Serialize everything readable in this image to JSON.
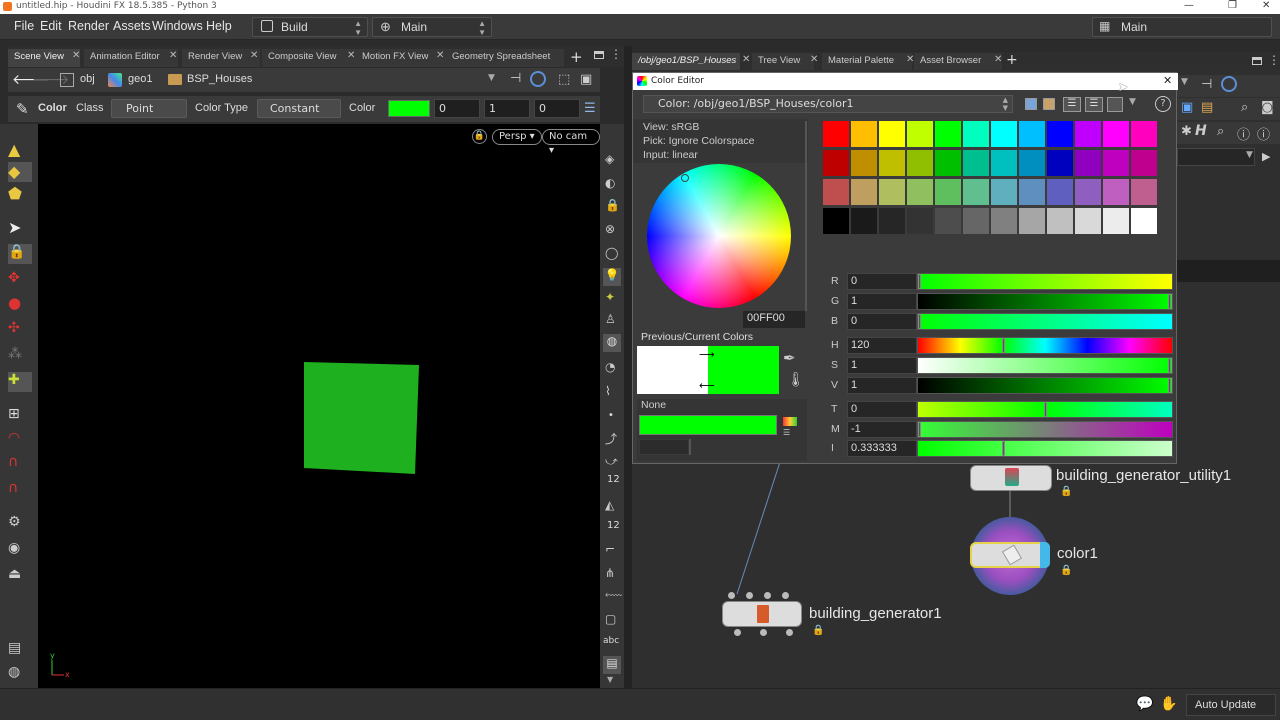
{
  "window": {
    "title": "untitled.hip - Houdini FX 18.5.385 - Python 3",
    "controls": [
      "—",
      "❐",
      "✕"
    ]
  },
  "menu": {
    "items": [
      "File",
      "Edit",
      "Render",
      "Assets",
      "Windows",
      "Help"
    ],
    "desktop": "Build",
    "main_left": "Main",
    "main_right": "Main"
  },
  "left_tabs": [
    {
      "label": "Scene View",
      "active": true
    },
    {
      "label": "Animation Editor"
    },
    {
      "label": "Render View"
    },
    {
      "label": "Composite View"
    },
    {
      "label": "Motion FX View"
    },
    {
      "label": "Geometry Spreadsheet"
    }
  ],
  "left_path": {
    "root": "obj",
    "geo": "geo1",
    "node": "BSP_Houses"
  },
  "parm": {
    "color_label": "Color",
    "class_label": "Class",
    "class_value": "Point",
    "color_type_label": "Color Type",
    "color_type_value": "Constant",
    "color_field_label": "Color",
    "color_swatch": "#00ff00",
    "r": "0",
    "g": "1",
    "b": "0"
  },
  "viewport": {
    "persp": "Persp",
    "cam": "No cam",
    "bg": "#000000",
    "box_color": "#1eb01e",
    "axis": "y",
    "axis_x": "x"
  },
  "right_tabs": [
    {
      "label": "/obj/geo1/BSP_Houses",
      "active": true
    },
    {
      "label": "Tree View"
    },
    {
      "label": "Material Palette"
    },
    {
      "label": "Asset Browser"
    }
  ],
  "color_editor": {
    "title": "Color Editor",
    "path": "Color: /obj/geo1/BSP_Houses/color1",
    "view": "View:  sRGB",
    "pick": "Pick:  Ignore Colorspace",
    "input": "Input:  linear",
    "hex": "00FF00",
    "prev_label": "Previous/Current Colors",
    "none_label": "None",
    "prev_color": "#ffffff",
    "current_color": "#00ff00",
    "palette": [
      [
        "#ff0000",
        "#ffbf00",
        "#ffff00",
        "#bfff00",
        "#00ff00",
        "#00ffbf",
        "#00ffff",
        "#00bfff",
        "#0000ff",
        "#bf00ff",
        "#ff00ff",
        "#ff00bf"
      ],
      [
        "#bf0000",
        "#bf8f00",
        "#bfbf00",
        "#8fbf00",
        "#00bf00",
        "#00bf8f",
        "#00bfbf",
        "#008fbf",
        "#0000bf",
        "#8f00bf",
        "#bf00bf",
        "#bf008f"
      ],
      [
        "#bf4f4f",
        "#bf9f5f",
        "#afbf5f",
        "#8fbf5f",
        "#5fbf5f",
        "#5fbf8f",
        "#5fafbf",
        "#5f8fbf",
        "#5f5fbf",
        "#8f5fbf",
        "#bf5fbf",
        "#bf5f8f"
      ],
      [
        "#000000",
        "#1a1a1a",
        "#262626",
        "#333333",
        "#4d4d4d",
        "#666666",
        "#808080",
        "#a6a6a6",
        "#c0c0c0",
        "#d9d9d9",
        "#ececec",
        "#ffffff"
      ]
    ],
    "sliders": [
      {
        "label": "R",
        "value": "0",
        "grad": "linear-gradient(to right,#00ff00,#ffff00)",
        "pos": 0
      },
      {
        "label": "G",
        "value": "1",
        "grad": "linear-gradient(to right,#000000,#00ff00)",
        "pos": 1
      },
      {
        "label": "B",
        "value": "0",
        "grad": "linear-gradient(to right,#00ff00,#00ffff)",
        "pos": 0
      },
      {
        "label": "H",
        "value": "120",
        "grad": "linear-gradient(to right,#ff0000,#ffff00,#00ff00,#00ffff,#0000ff,#ff00ff,#ff0000)",
        "pos": 0.333
      },
      {
        "label": "S",
        "value": "1",
        "grad": "linear-gradient(to right,#ffffff,#00ff00)",
        "pos": 1
      },
      {
        "label": "V",
        "value": "1",
        "grad": "linear-gradient(to right,#000000,#00ff00)",
        "pos": 1
      },
      {
        "label": "T",
        "value": "0",
        "grad": "linear-gradient(to right,#bfff00,#00ff00,#00ffbf)",
        "pos": 0.5
      },
      {
        "label": "M",
        "value": "-1",
        "grad": "linear-gradient(to right,#33ff33,#bf00bf)",
        "pos": 0
      },
      {
        "label": "I",
        "value": "0.333333",
        "grad": "linear-gradient(to right,#00ff00,#ccffcc)",
        "pos": 0.333
      }
    ]
  },
  "nodes": {
    "utility": "building_generator_utility1",
    "color": "color1",
    "generator": "building_generator1"
  },
  "status": {
    "auto_update": "Auto Update"
  },
  "toolbar_text": {
    "twelve": "12",
    "abc": "abc"
  }
}
